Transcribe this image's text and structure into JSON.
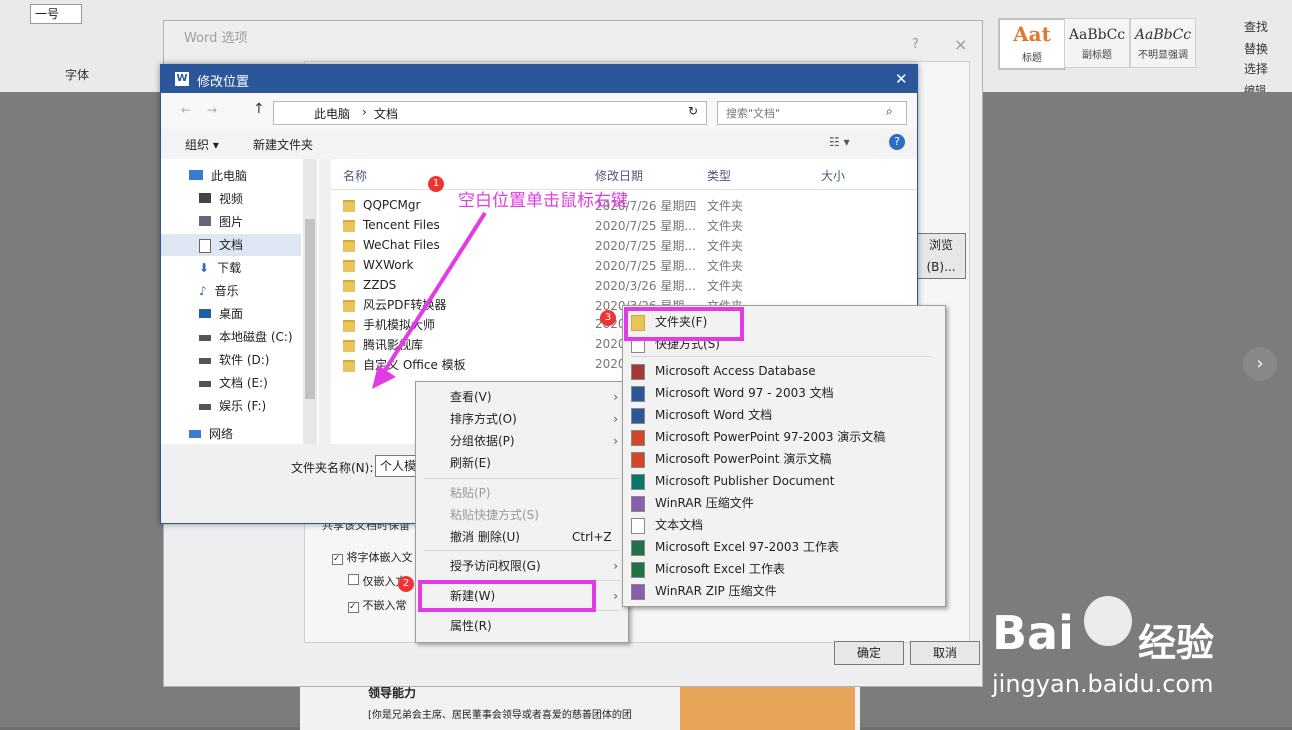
{
  "ribbon": {
    "font_size_label": "一号",
    "font_group": "字体",
    "edit_group": "编辑",
    "style_tiles": [
      {
        "preview": "Aat",
        "label": "标题"
      },
      {
        "preview": "AaBbCc",
        "label": "副标题"
      },
      {
        "preview": "AaBbCc",
        "label": "不明显强调"
      }
    ],
    "edit_items": [
      "查找",
      "替换",
      "选择"
    ]
  },
  "word_options": {
    "title": "Word 选项",
    "help": "?",
    "close": "×"
  },
  "dialog": {
    "title": "修改位置",
    "breadcrumb": [
      "此电脑",
      "文档"
    ],
    "search_placeholder": "搜索\"文档\"",
    "toolbar": {
      "organize": "组织",
      "new_folder": "新建文件夹"
    },
    "nav_items": [
      "此电脑",
      "视频",
      "图片",
      "文档",
      "下载",
      "音乐",
      "桌面",
      "本地磁盘 (C:)",
      "软件 (D:)",
      "文档 (E:)",
      "娱乐 (F:)",
      "网络"
    ],
    "columns": [
      "名称",
      "修改日期",
      "类型",
      "大小"
    ],
    "files": [
      {
        "name": "QQPCMgr",
        "date": "2020/7/26 星期四",
        "type": "文件夹"
      },
      {
        "name": "Tencent Files",
        "date": "2020/7/25 星期...",
        "type": "文件夹"
      },
      {
        "name": "WeChat Files",
        "date": "2020/7/25 星期...",
        "type": "文件夹"
      },
      {
        "name": "WXWork",
        "date": "2020/7/25 星期...",
        "type": "文件夹"
      },
      {
        "name": "ZZDS",
        "date": "2020/3/26 星期...",
        "type": "文件夹"
      },
      {
        "name": "风云PDF转换器",
        "date": "2020/3/26 星期...",
        "type": "文件夹"
      },
      {
        "name": "手机模拟大师",
        "date": "2020",
        "type": ""
      },
      {
        "name": "腾讯影视库",
        "date": "2020",
        "type": ""
      },
      {
        "name": "自定义 Office 模板",
        "date": "2020",
        "type": ""
      }
    ],
    "folder_name_label": "文件夹名称(N):",
    "folder_name_value": "个人模"
  },
  "context_menu": {
    "items": [
      {
        "label": "查看(V)",
        "submenu": true,
        "disabled": false
      },
      {
        "label": "排序方式(O)",
        "submenu": true,
        "disabled": false
      },
      {
        "label": "分组依据(P)",
        "submenu": true,
        "disabled": false
      },
      {
        "label": "刷新(E)",
        "submenu": false,
        "disabled": false
      },
      {
        "label": "粘贴(P)",
        "submenu": false,
        "disabled": true
      },
      {
        "label": "粘贴快捷方式(S)",
        "submenu": false,
        "disabled": true
      },
      {
        "label": "撤消 删除(U)",
        "shortcut": "Ctrl+Z",
        "submenu": false,
        "disabled": false
      },
      {
        "label": "授予访问权限(G)",
        "submenu": true,
        "disabled": false
      },
      {
        "label": "新建(W)",
        "submenu": true,
        "disabled": false
      },
      {
        "label": "属性(R)",
        "submenu": false,
        "disabled": false
      }
    ]
  },
  "submenu": {
    "items": [
      "文件夹(F)",
      "快捷方式(S)",
      "Microsoft Access Database",
      "Microsoft Word 97 - 2003 文档",
      "Microsoft Word 文档",
      "Microsoft PowerPoint 97-2003 演示文稿",
      "Microsoft PowerPoint 演示文稿",
      "Microsoft Publisher Document",
      "WinRAR 压缩文件",
      "文本文档",
      "Microsoft Excel 97-2003 工作表",
      "Microsoft Excel 工作表",
      "WinRAR ZIP 压缩文件"
    ],
    "icon_colors": [
      "#e8c45a",
      "#ffffff",
      "#a4373a",
      "#2b579a",
      "#2b579a",
      "#d24726",
      "#d24726",
      "#077568",
      "#8a5fb0",
      "#ffffff",
      "#217346",
      "#217346",
      "#8a5fb0"
    ]
  },
  "options_bg": {
    "share_label": "共享该文档时保留",
    "embed_fonts": "将字体嵌入文",
    "embed_only": "仅嵌入文",
    "no_embed": "不嵌入常",
    "ok": "确定",
    "cancel": "取消",
    "browse": "浏览(B)..."
  },
  "annotations": {
    "step1": "1",
    "step2": "2",
    "step3": "3",
    "instruction": "空白位置单击鼠标右键"
  },
  "document": {
    "heading": "领导能力",
    "body": "[你是兄弟会主席、居民董事会领导或者喜爱的慈善团体的团"
  },
  "watermark": {
    "brand": "Bai",
    "cn": "经验",
    "url": "jingyan.baidu.com"
  }
}
